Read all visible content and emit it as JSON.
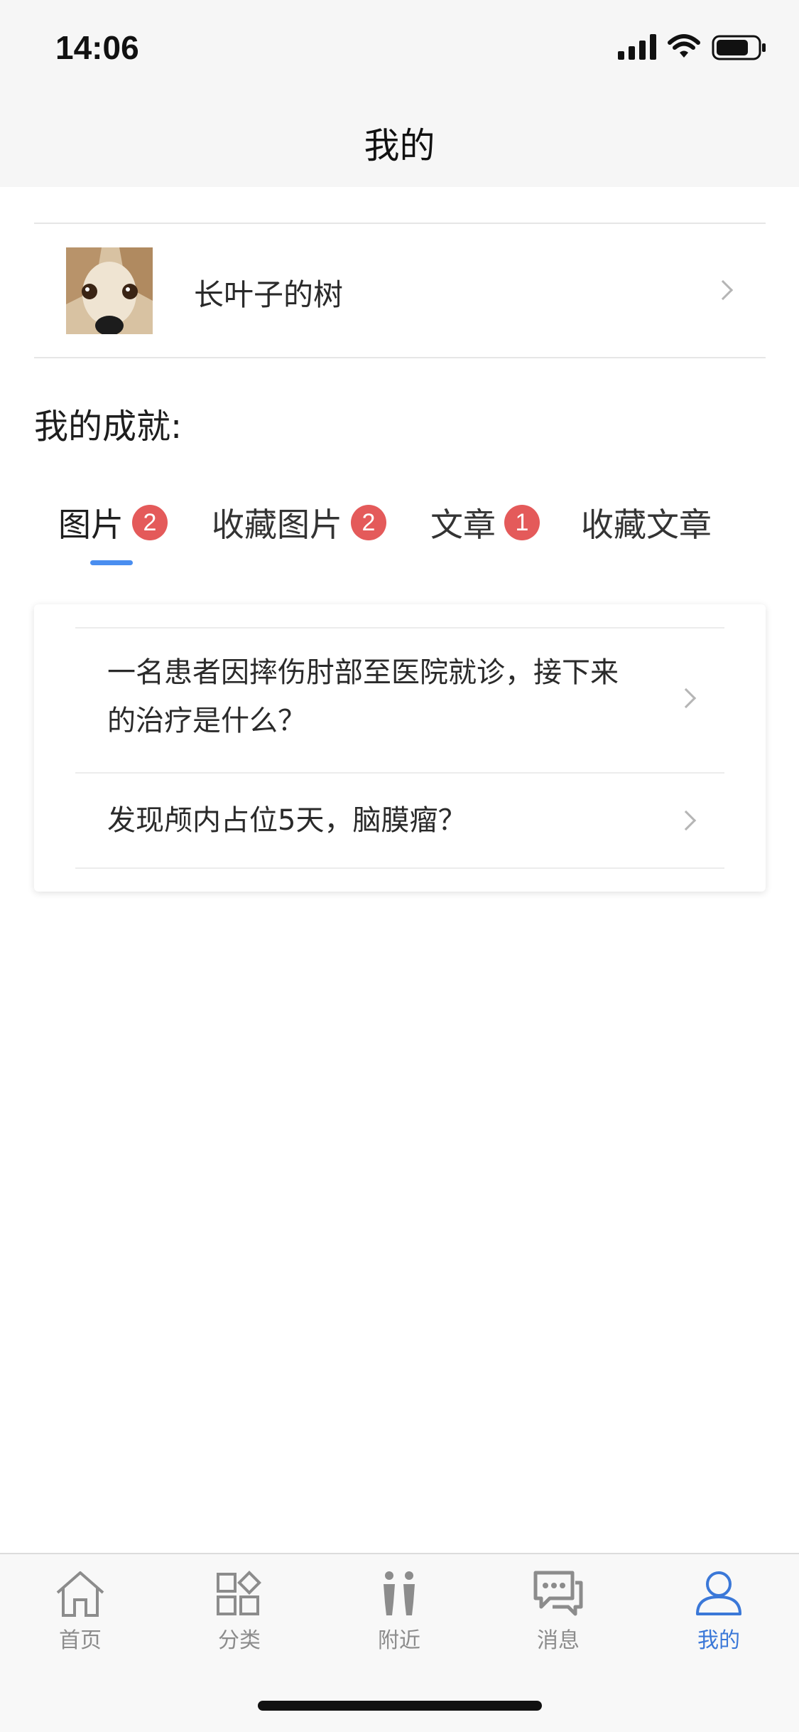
{
  "status_bar": {
    "time": "14:06"
  },
  "nav": {
    "title": "我的"
  },
  "profile": {
    "username": "长叶子的树"
  },
  "achievements": {
    "title": "我的成就:"
  },
  "tabs": [
    {
      "label": "图片",
      "badge": "2",
      "active": true
    },
    {
      "label": "收藏图片",
      "badge": "2",
      "active": false
    },
    {
      "label": "文章",
      "badge": "1",
      "active": false
    },
    {
      "label": "收藏文章",
      "badge": "",
      "active": false
    }
  ],
  "articles": [
    {
      "title": "一名患者因摔伤肘部至医院就诊，接下来的治疗是什么？"
    },
    {
      "title": "发现颅内占位5天，脑膜瘤？"
    }
  ],
  "tabbar": [
    {
      "label": "首页",
      "icon": "home-icon"
    },
    {
      "label": "分类",
      "icon": "category-icon"
    },
    {
      "label": "附近",
      "icon": "nearby-icon"
    },
    {
      "label": "消息",
      "icon": "message-icon"
    },
    {
      "label": "我的",
      "icon": "profile-icon",
      "active": true
    }
  ],
  "colors": {
    "accent": "#3b78d8",
    "badge": "#e45a5a",
    "underline": "#4a8ef0"
  }
}
